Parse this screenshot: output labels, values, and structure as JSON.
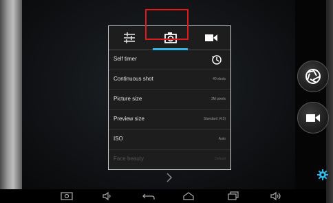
{
  "menu": {
    "tabs": [
      {
        "icon": "sliders-icon",
        "selected": false
      },
      {
        "icon": "camera-icon",
        "selected": true
      },
      {
        "icon": "video-camera-icon",
        "selected": false
      }
    ],
    "rows": [
      {
        "label": "Self timer",
        "value": "",
        "icon": "timer-icon"
      },
      {
        "label": "Continuous shot",
        "value": "40 shots"
      },
      {
        "label": "Picture size",
        "value": "3M pixels"
      },
      {
        "label": "Preview size",
        "value": "Standard (4:3)"
      },
      {
        "label": "ISO",
        "value": "Auto"
      },
      {
        "label": "Face beauty",
        "value": "Default",
        "disabled": true
      }
    ],
    "more_icon": "chevron-down-icon"
  },
  "side_controls": {
    "shutter_icon": "shutter-icon",
    "video_icon": "video-camera-icon",
    "settings_icon": "gear-icon"
  },
  "navbar": {
    "buttons": [
      "screenshot-icon",
      "volume-down-icon",
      "back-icon",
      "home-icon",
      "recent-apps-icon",
      "volume-up-icon"
    ]
  },
  "colors": {
    "accent": "#33b5e5",
    "highlight": "#e01b1b"
  }
}
